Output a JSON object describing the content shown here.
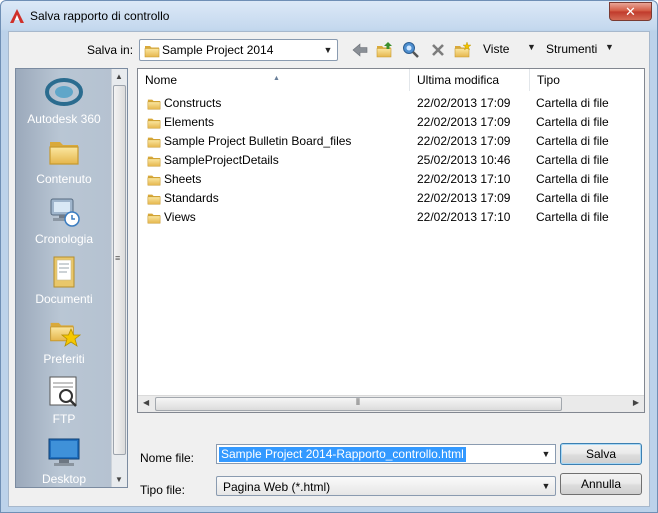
{
  "window": {
    "title": "Salva rapporto di controllo",
    "close_glyph": "✕"
  },
  "toolbar": {
    "lookin_label": "Salva in:",
    "lookin_value": "Sample Project 2014",
    "views_label": "Viste",
    "tools_label": "Strumenti",
    "icons": [
      "back-icon",
      "up-folder-icon",
      "search-web-icon",
      "delete-icon",
      "new-folder-icon"
    ]
  },
  "places": [
    {
      "label": "Autodesk 360",
      "icon": "autodesk-360-icon"
    },
    {
      "label": "Contenuto",
      "icon": "content-folder-icon"
    },
    {
      "label": "Cronologia",
      "icon": "history-icon"
    },
    {
      "label": "Documenti",
      "icon": "documents-icon"
    },
    {
      "label": "Preferiti",
      "icon": "favorites-icon"
    },
    {
      "label": "FTP",
      "icon": "ftp-icon"
    },
    {
      "label": "Desktop",
      "icon": "desktop-icon"
    }
  ],
  "filelist": {
    "columns": {
      "name": "Nome",
      "modified": "Ultima modifica",
      "type": "Tipo"
    },
    "rows": [
      {
        "name": "Constructs",
        "modified": "22/02/2013 17:09",
        "type": "Cartella di file"
      },
      {
        "name": "Elements",
        "modified": "22/02/2013 17:09",
        "type": "Cartella di file"
      },
      {
        "name": "Sample Project Bulletin Board_files",
        "modified": "22/02/2013 17:09",
        "type": "Cartella di file"
      },
      {
        "name": "SampleProjectDetails",
        "modified": "25/02/2013 10:46",
        "type": "Cartella di file"
      },
      {
        "name": "Sheets",
        "modified": "22/02/2013 17:10",
        "type": "Cartella di file"
      },
      {
        "name": "Standards",
        "modified": "22/02/2013 17:09",
        "type": "Cartella di file"
      },
      {
        "name": "Views",
        "modified": "22/02/2013 17:10",
        "type": "Cartella di file"
      }
    ]
  },
  "form": {
    "filename_label": "Nome file:",
    "filename_value": "Sample Project 2014-Rapporto_controllo.html",
    "filetype_label": "Tipo file:",
    "filetype_value": "Pagina Web (*.html)",
    "save_label": "Salva",
    "cancel_label": "Annulla"
  },
  "colors": {
    "selection": "#3399ff",
    "places_bg": "#b4c1d0",
    "close_button": "#c0392b"
  }
}
